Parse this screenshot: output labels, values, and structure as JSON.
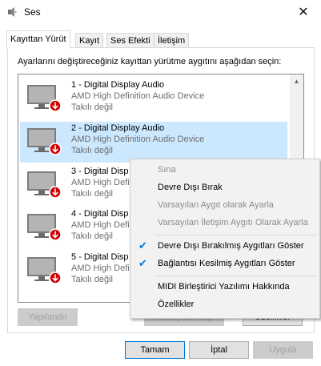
{
  "window": {
    "title": "Ses",
    "close_glyph": "✕"
  },
  "tabs": [
    {
      "label": "Kayıttan Yürüt",
      "active": true
    },
    {
      "label": "Kayıt"
    },
    {
      "label": "Ses Efekti"
    },
    {
      "label": "İletişim"
    }
  ],
  "instruction": "Ayarlarını değiştireceğiniz kayıttan yürütme aygıtını aşağıdan seçin:",
  "devices": [
    {
      "name": "1 - Digital Display Audio",
      "desc": "AMD High Definition Audio Device",
      "state": "Takılı değil"
    },
    {
      "name": "2 - Digital Display Audio",
      "desc": "AMD High Definition Audio Device",
      "state": "Takılı değil",
      "selected": true
    },
    {
      "name": "3 - Digital Disp",
      "desc": "AMD High Defin",
      "state": "Takılı değil"
    },
    {
      "name": "4 - Digital Disp",
      "desc": "AMD High Defin",
      "state": "Takılı değil"
    },
    {
      "name": "5 - Digital Disp",
      "desc": "AMD High Defin",
      "state": "Takılı değil"
    }
  ],
  "buttons": {
    "configure": "Yapılandır",
    "set_default": "Varsayılan Yap",
    "properties": "Özellikler",
    "ok": "Tamam",
    "cancel": "İptal",
    "apply": "Uygula"
  },
  "context_menu": {
    "test": "Sına",
    "disable": "Devre Dışı Bırak",
    "set_default_device": "Varsayılan Aygıt olarak Ayarla",
    "set_default_comm": "Varsayılan İletişim Aygıtı Olarak Ayarla",
    "show_disabled": "Devre Dışı Bırakılmış Aygıtları Göster",
    "show_disconnected": "Bağlantısı Kesilmiş Aygıtları Göster",
    "midi_about": "MIDI Birleştirici Yazılımı Hakkında",
    "properties": "Özellikler"
  },
  "colors": {
    "selection": "#cce8ff",
    "accent": "#0078d7",
    "badge_red": "#d00000"
  },
  "icons": {
    "app": "speaker-icon",
    "device": "monitor-icon",
    "badge": "down-arrow-badge-icon",
    "check": "checkmark-icon"
  }
}
